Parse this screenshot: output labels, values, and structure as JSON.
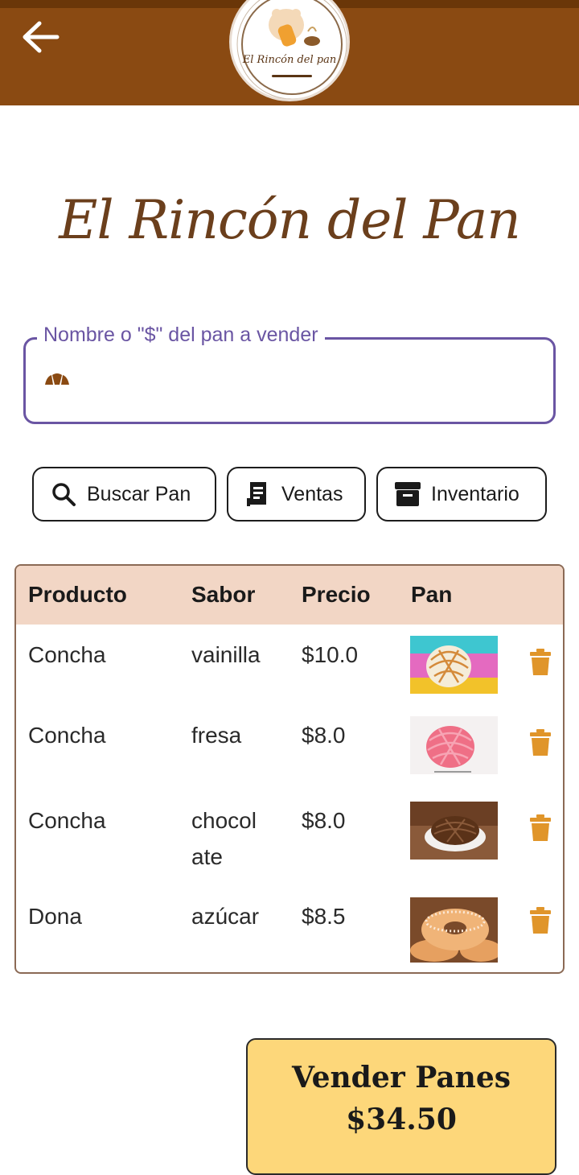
{
  "app": {
    "logo_text": "El Rincón del pan",
    "title": "El Rincón del Pan"
  },
  "search": {
    "label": "Nombre o \"$\" del pan a vender",
    "value": ""
  },
  "actions": {
    "buscar": "Buscar Pan",
    "ventas": "Ventas",
    "inventario": "Inventario"
  },
  "table": {
    "headers": [
      "Producto",
      "Sabor",
      "Precio",
      "Pan"
    ],
    "rows": [
      {
        "producto": "Concha",
        "sabor_1": "vainilla",
        "sabor_2": "",
        "precio": "$10.0",
        "image": "concha-vainilla"
      },
      {
        "producto": "Concha",
        "sabor_1": "fresa",
        "sabor_2": "",
        "precio": "$8.0",
        "image": "concha-fresa"
      },
      {
        "producto": "Concha",
        "sabor_1": "chocol",
        "sabor_2": "ate",
        "precio": "$8.0",
        "image": "concha-chocolate"
      },
      {
        "producto": "Dona",
        "sabor_1": "azúcar",
        "sabor_2": "",
        "precio": "$8.5",
        "image": "dona-azucar"
      }
    ]
  },
  "sell": {
    "label": "Vender Panes",
    "total": "$34.50"
  },
  "colors": {
    "appbar": "#8a4a12",
    "accent_purple": "#6a55a3",
    "header_row": "#f2d6c5",
    "trash": "#e0952a",
    "sell_button": "#fdd77a"
  },
  "icons": [
    "back-arrow-icon",
    "croissant-icon",
    "search-icon",
    "receipt-icon",
    "archive-box-icon",
    "trash-icon"
  ]
}
